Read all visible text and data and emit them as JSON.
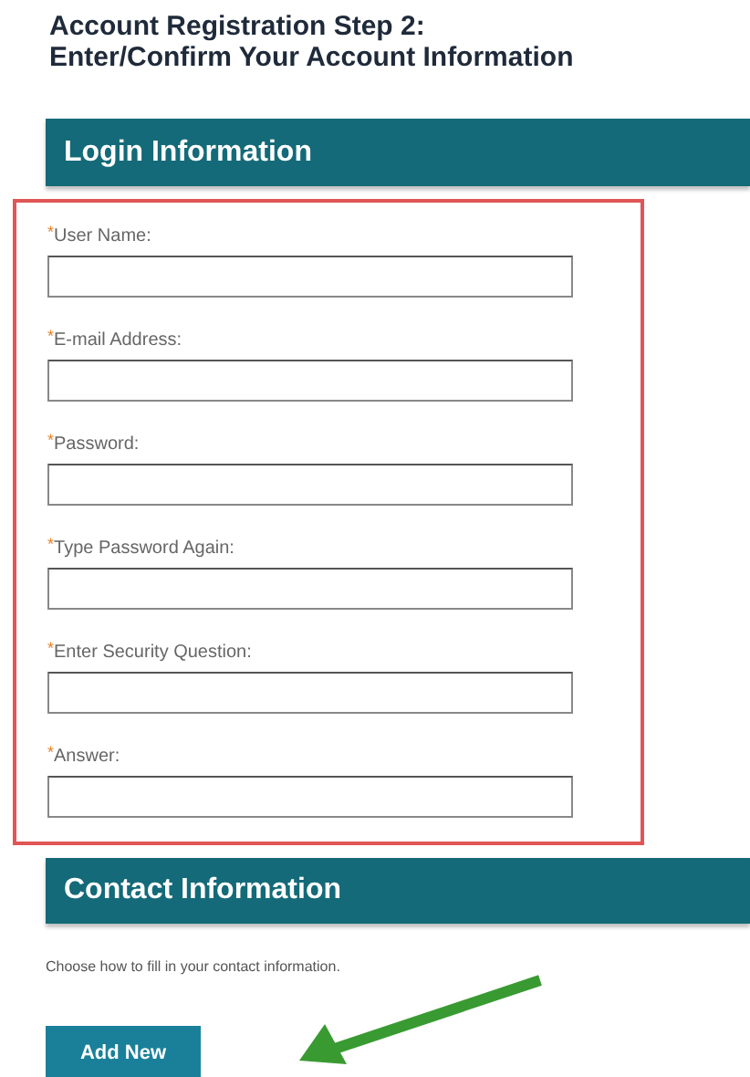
{
  "title_lines": [
    "Account Registration Step 2:",
    "Enter/Confirm Your Account Information"
  ],
  "login_section": {
    "heading": "Login Information",
    "fields": [
      {
        "label": "User Name:",
        "required": true
      },
      {
        "label": "E-mail Address:",
        "required": true
      },
      {
        "label": "Password:",
        "required": true
      },
      {
        "label": "Type Password Again:",
        "required": true
      },
      {
        "label": "Enter Security Question:",
        "required": true
      },
      {
        "label": "Answer:",
        "required": true
      }
    ]
  },
  "contact_section": {
    "heading": "Contact Information",
    "hint": "Choose how to fill in your contact information.",
    "button": "Add New"
  },
  "required_mark": "*"
}
